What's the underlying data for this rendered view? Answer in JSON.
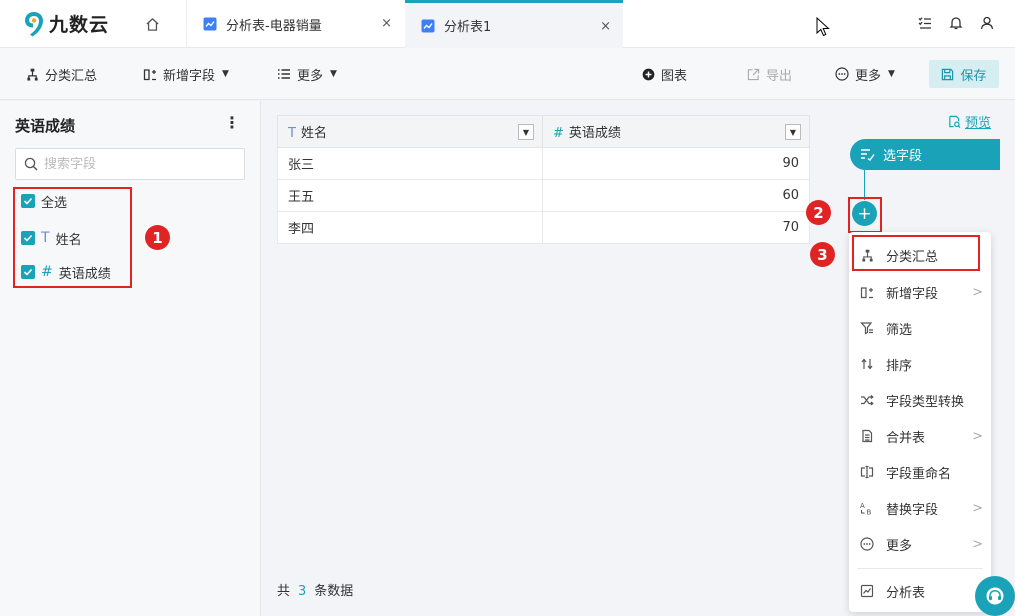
{
  "brand": {
    "name": "九数云",
    "accent": "#1aa3b8",
    "highlight": "#e02424"
  },
  "tabs": [
    {
      "label": "分析表-电器销量",
      "close": "×"
    },
    {
      "label": "分析表1",
      "close": "×"
    }
  ],
  "toolbar": {
    "group_summary": "分类汇总",
    "add_field": "新增字段",
    "more_left": "更多",
    "chart": "图表",
    "export": "导出",
    "more_right": "更多",
    "save": "保存"
  },
  "left_panel": {
    "title": "英语成绩",
    "more": "⋮",
    "search_placeholder": "搜索字段",
    "fields": [
      {
        "label": "全选",
        "type": "",
        "checked": true
      },
      {
        "label": "姓名",
        "type": "T",
        "checked": true
      },
      {
        "label": "英语成绩",
        "type": "#",
        "checked": true
      }
    ]
  },
  "annotations": [
    "1",
    "2",
    "3"
  ],
  "table": {
    "columns": [
      {
        "name": "姓名",
        "type": "T"
      },
      {
        "name": "英语成绩",
        "type": "#"
      }
    ],
    "rows": [
      [
        "张三",
        "90"
      ],
      [
        "王五",
        "60"
      ],
      [
        "李四",
        "70"
      ]
    ],
    "footer": {
      "prefix": "共",
      "count": "3",
      "suffix": "条数据"
    }
  },
  "flow": {
    "preview": "预览",
    "step": "选字段",
    "plus": "+"
  },
  "menu": {
    "items": [
      {
        "label": "分类汇总",
        "icon": "hierarchy-icon",
        "submenu": false
      },
      {
        "label": "新增字段",
        "icon": "add-field-icon",
        "submenu": true
      },
      {
        "label": "筛选",
        "icon": "filter-icon",
        "submenu": false
      },
      {
        "label": "排序",
        "icon": "sort-icon",
        "submenu": false
      },
      {
        "label": "字段类型转换",
        "icon": "shuffle-icon",
        "submenu": false
      },
      {
        "label": "合并表",
        "icon": "merge-table-icon",
        "submenu": true
      },
      {
        "label": "字段重命名",
        "icon": "rename-icon",
        "submenu": false
      },
      {
        "label": "替换字段",
        "icon": "replace-icon",
        "submenu": true
      },
      {
        "label": "更多",
        "icon": "more-circle-icon",
        "submenu": true
      },
      {
        "label": "分析表",
        "icon": "analysis-table-icon",
        "submenu": false
      }
    ]
  }
}
